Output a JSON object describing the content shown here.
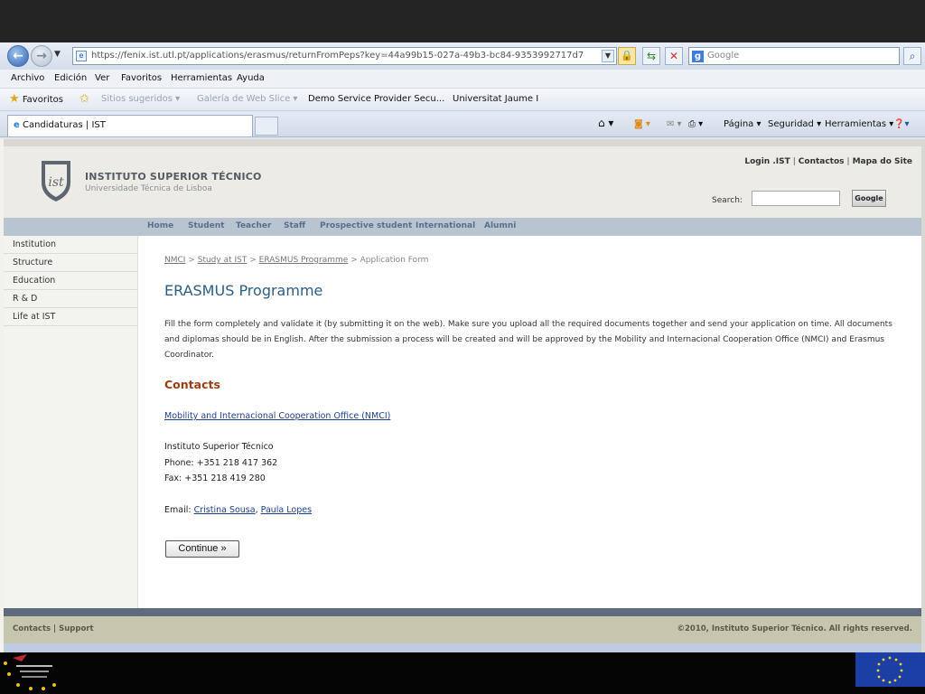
{
  "browser": {
    "url": "https://fenix.ist.utl.pt/applications/erasmus/returnFromPeps?key=44a99b15-027a-49b3-bc84-9353992717d7",
    "search_placeholder": "Google",
    "menu": [
      "Archivo",
      "Edición",
      "Ver",
      "Favoritos",
      "Herramientas",
      "Ayuda"
    ],
    "favorites_label": "Favoritos",
    "favorites_items": [
      "Sitios sugeridos ▾",
      "Galería de Web Slice ▾",
      "Demo Service Provider Secu...",
      "Universitat Jaume I"
    ],
    "tab_title": "Candidaturas | IST",
    "command_bar": {
      "page": "Página ▾",
      "security": "Seguridad ▾",
      "tools": "Herramientas ▾"
    }
  },
  "site": {
    "logo_title": "INSTITUTO SUPERIOR TÉCNICO",
    "logo_subtitle": "Universidade Técnica de Lisboa",
    "top_links": [
      "Login .IST",
      "Contactos",
      "Mapa do Site"
    ],
    "search_label": "Search:",
    "search_button": "Google",
    "main_nav": [
      "Home",
      "Student",
      "Teacher",
      "Staff",
      "Prospective student",
      "International",
      "Alumni"
    ],
    "left_nav": [
      "Institution",
      "Structure",
      "Education",
      "R & D",
      "Life at IST"
    ],
    "breadcrumb": {
      "items": [
        "NMCI",
        "Study at IST",
        "ERASMUS Programme"
      ],
      "current": "Application Form",
      "separator": ">"
    },
    "title": "ERASMUS Programme",
    "intro": "Fill the form completely and validate it (by submitting it on the web). Make sure you upload all the required documents together and send your application on time. All documents and diplomas should be in English. After the submission a process will be created and will be approved by the Mobility and Internacional Cooperation Office (NMCI) and Erasmus Coordinator.",
    "contacts_heading": "Contacts",
    "office_link": "Mobility and Internacional Cooperation Office (NMCI)",
    "institution": "Instituto Superior Técnico",
    "phone": "Phone: +351 218 417 362",
    "fax": "Fax: +351 218 419 280",
    "email_label": "Email:",
    "email_contacts": [
      "Cristina Sousa",
      "Paula Lopes"
    ],
    "continue_button": "Continue »",
    "footer_links": "Contacts | Support",
    "copyright": "©2010, Instituto Superior Técnico. All rights reserved."
  },
  "colors": {
    "heading_blue": "#2c5d82",
    "contacts_brown": "#9a3f13",
    "nav_bar": "#b9c4d1",
    "footer": "#c6c5ad"
  }
}
